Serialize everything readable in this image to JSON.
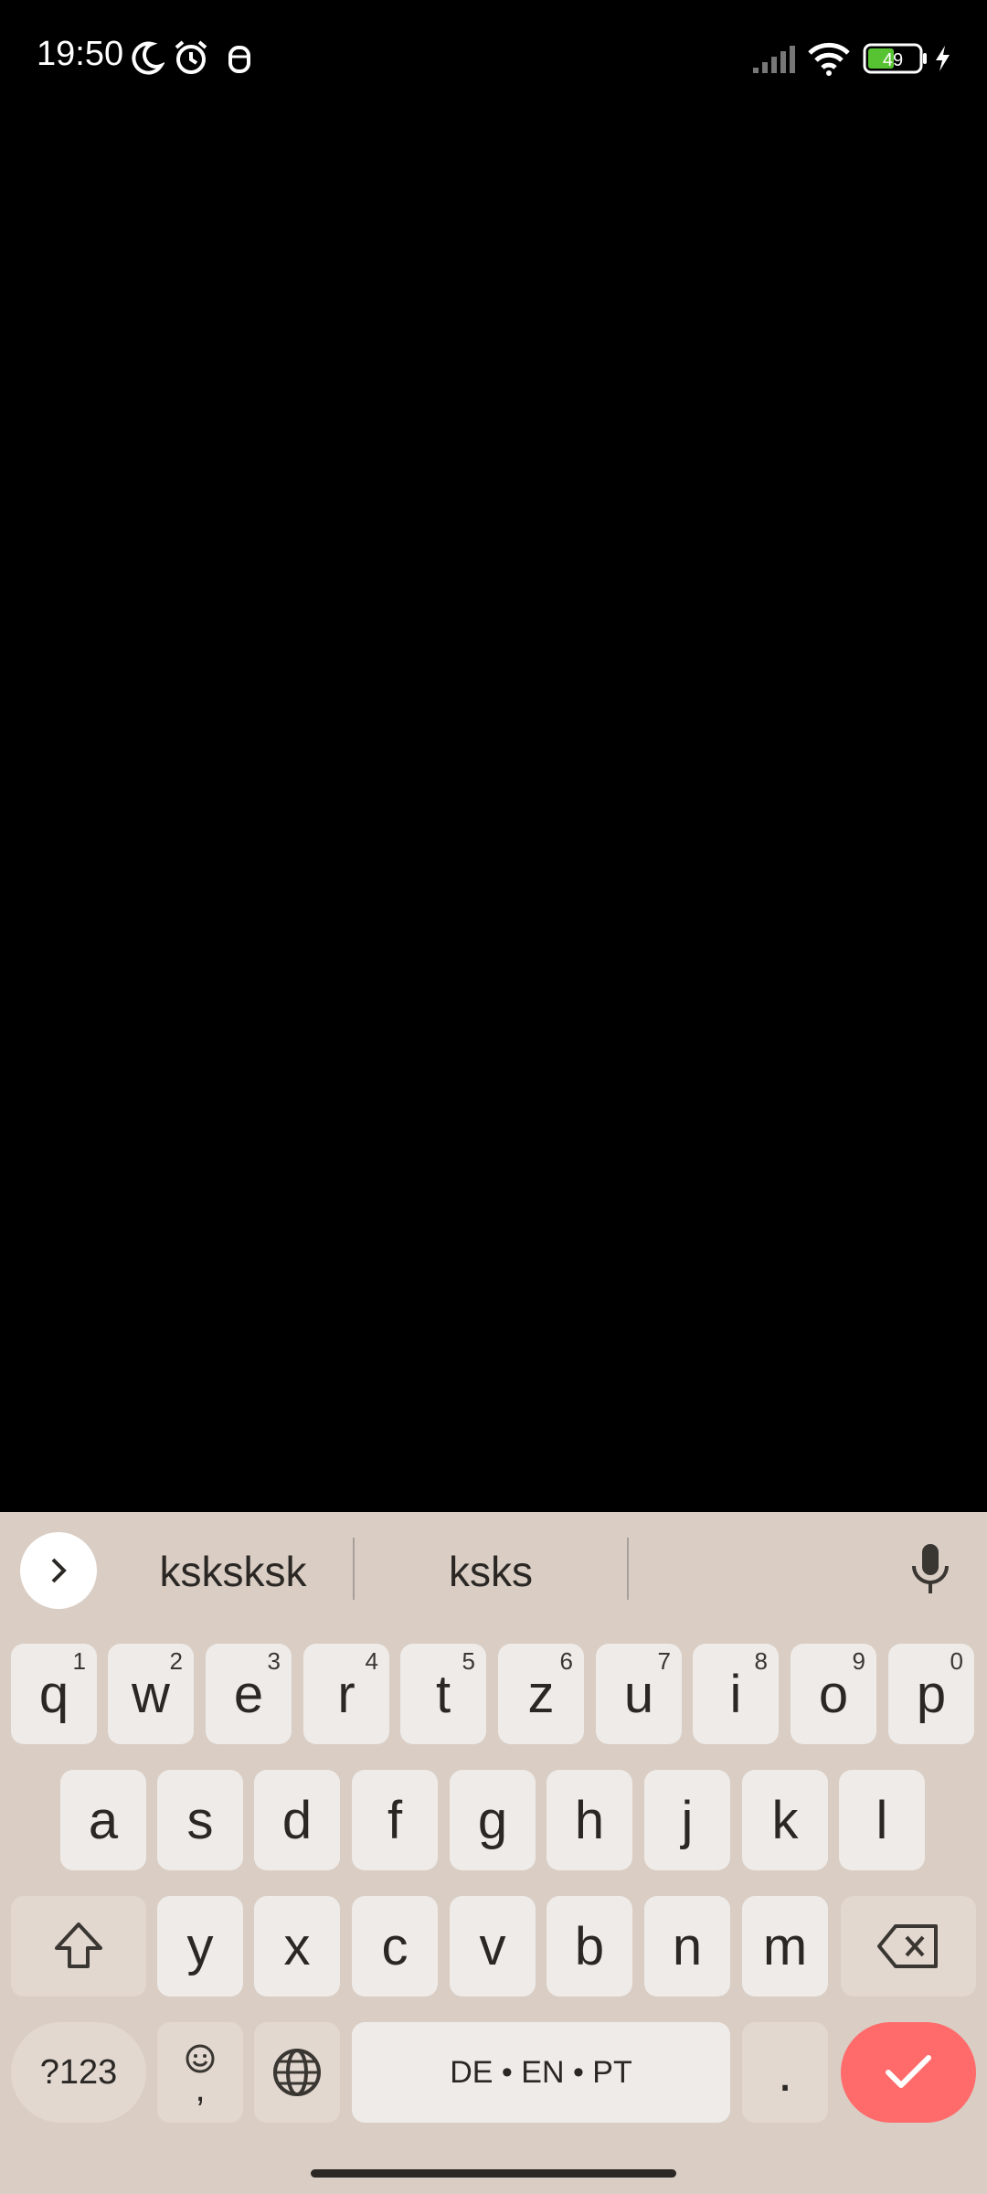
{
  "status_bar": {
    "time": "19:50",
    "icons": [
      "moon-icon",
      "alarm-icon",
      "mouse-icon",
      "signal-icon",
      "wifi-icon",
      "battery-icon",
      "charging-icon"
    ],
    "battery_level": "49"
  },
  "keyboard": {
    "suggestions": [
      "ksksksk",
      "ksks",
      ""
    ],
    "row1": [
      {
        "key": "q",
        "hint": "1"
      },
      {
        "key": "w",
        "hint": "2"
      },
      {
        "key": "e",
        "hint": "3"
      },
      {
        "key": "r",
        "hint": "4"
      },
      {
        "key": "t",
        "hint": "5"
      },
      {
        "key": "z",
        "hint": "6"
      },
      {
        "key": "u",
        "hint": "7"
      },
      {
        "key": "i",
        "hint": "8"
      },
      {
        "key": "o",
        "hint": "9"
      },
      {
        "key": "p",
        "hint": "0"
      }
    ],
    "row2": [
      "a",
      "s",
      "d",
      "f",
      "g",
      "h",
      "j",
      "k",
      "l"
    ],
    "row3": [
      "y",
      "x",
      "c",
      "v",
      "b",
      "n",
      "m"
    ],
    "symbols_label": "?123",
    "comma_label": ",",
    "space_label": "DE • EN • PT",
    "period_label": ".",
    "colors": {
      "background": "#d9cdc4",
      "key": "#eeebe8",
      "function_key": "#e2d8d0",
      "enter": "#ff6b6b"
    }
  }
}
